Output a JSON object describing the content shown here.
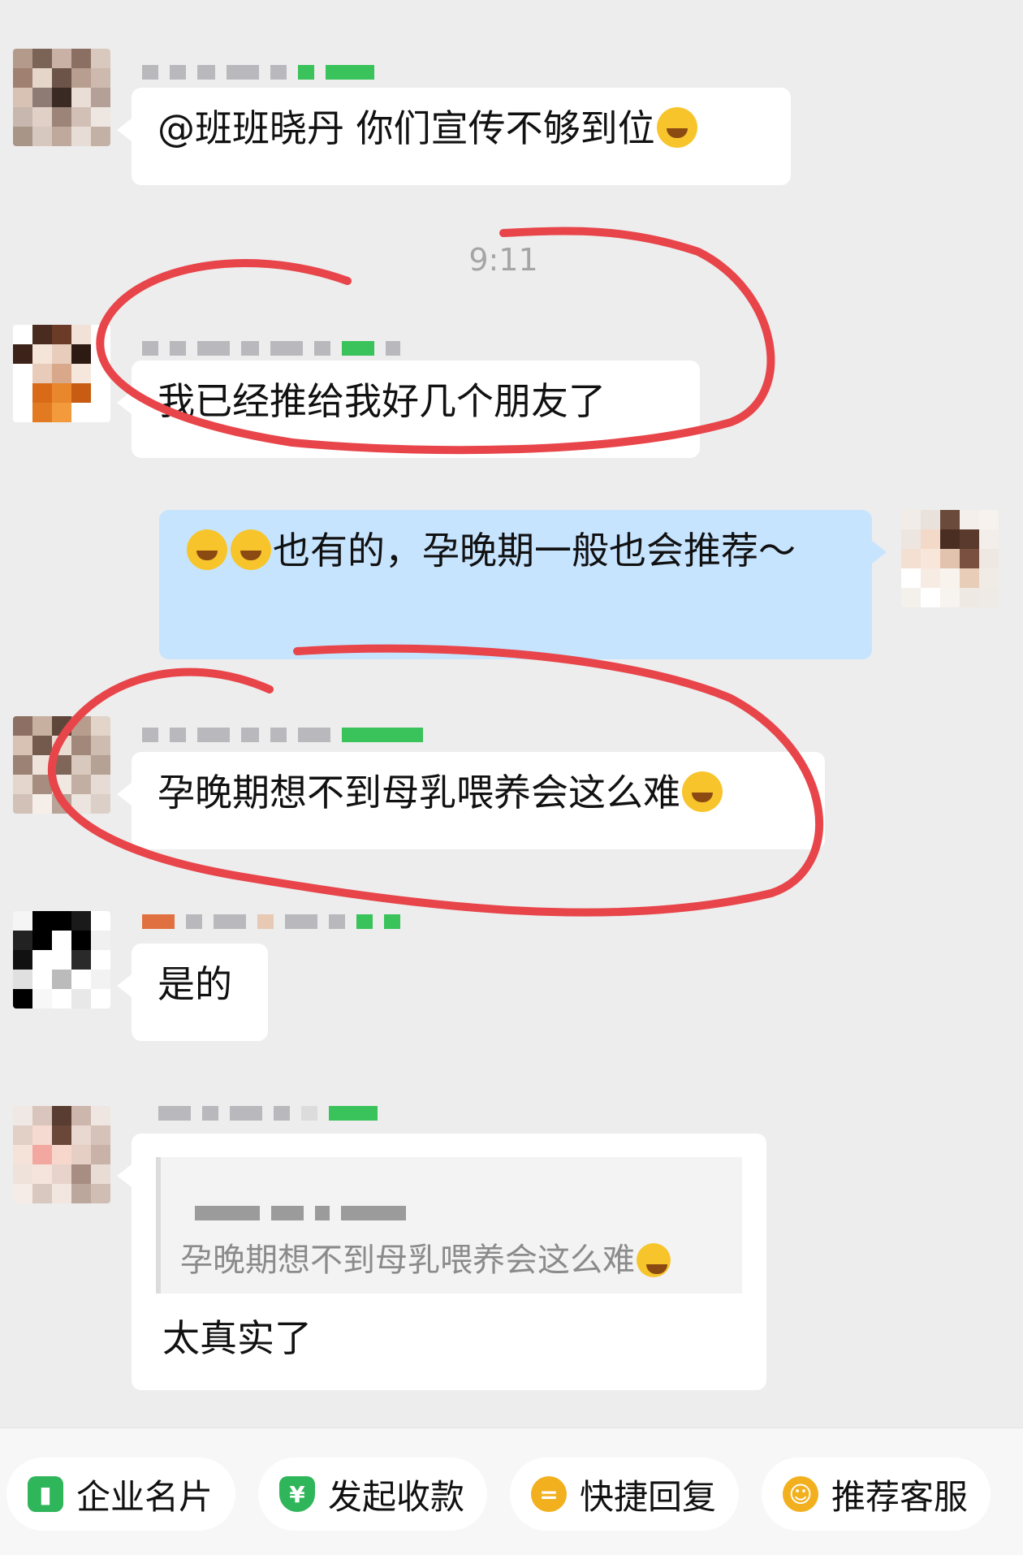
{
  "chat": {
    "time_divider": "9:11",
    "messages": [
      {
        "text": "@班班晓丹 你们宣传不够到位"
      },
      {
        "text": "我已经推给我好几个朋友了"
      },
      {
        "text": "也有的，孕晚期一般也会推荐～"
      },
      {
        "text": "孕晚期想不到母乳喂养会这么难"
      },
      {
        "text": "是的"
      },
      {
        "quote_text": "孕晚期想不到母乳喂养会这么难",
        "text": "太真实了"
      }
    ]
  },
  "quick_actions": [
    {
      "label": "企业名片",
      "icon": "business-card-icon",
      "color": "#2fb55a"
    },
    {
      "label": "发起收款",
      "icon": "payment-shield-icon",
      "color": "#2fb55a"
    },
    {
      "label": "快捷回复",
      "icon": "quick-reply-icon",
      "color": "#f2b01e"
    },
    {
      "label": "推荐客服",
      "icon": "service-agent-icon",
      "color": "#f2b01e"
    }
  ],
  "colors": {
    "annotation": "#e8454a",
    "my_bubble": "#c7e4ff",
    "background": "#ededed"
  }
}
